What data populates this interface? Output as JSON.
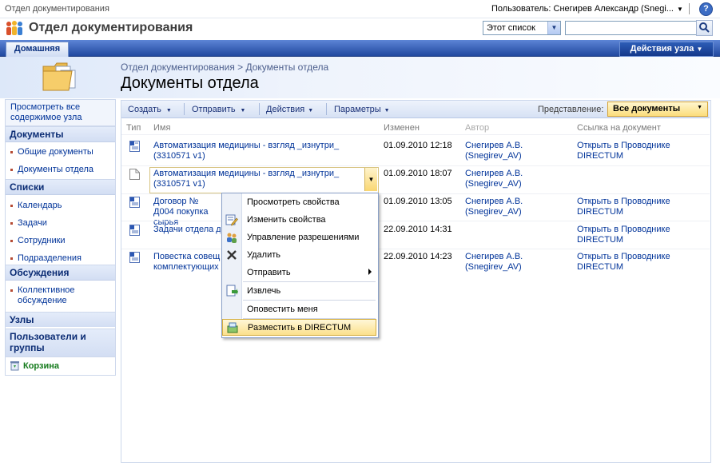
{
  "top": {
    "site_small": "Отдел документирования",
    "user": "Пользователь: Снегирев Александр (Snegi...",
    "help": "?"
  },
  "header": {
    "site_title": "Отдел документирования",
    "scope": "Этот список",
    "search_placeholder": ""
  },
  "tabs": {
    "home": "Домашняя",
    "site_actions": "Действия узла"
  },
  "title_area": {
    "breadcrumb": "Отдел документирования > Документы отдела",
    "page_title": "Документы отдела"
  },
  "nav": {
    "view_all": "Просмотреть все содержимое узла",
    "documents_head": "Документы",
    "documents": [
      "Общие документы",
      "Документы отдела"
    ],
    "lists_head": "Списки",
    "lists": [
      "Календарь",
      "Задачи",
      "Сотрудники",
      "Подразделения"
    ],
    "discussions_head": "Обсуждения",
    "discussions": [
      "Коллективное обсуждение"
    ],
    "sites_head": "Узлы",
    "people_head": "Пользователи и группы",
    "recycle": "Корзина"
  },
  "toolbar": {
    "create": "Создать",
    "send": "Отправить",
    "actions": "Действия",
    "settings": "Параметры",
    "view_label": "Представление:",
    "view_value": "Все документы"
  },
  "table": {
    "headers": [
      "Тип",
      "Имя",
      "Изменен",
      "Автор",
      "Ссылка на документ"
    ],
    "rows": [
      {
        "name": "Автоматизация медицины - взгляд _изнутри_ (3310571 v1)",
        "modified": "01.09.2010 12:18",
        "author": "Снегирев А.В. (Snegirev_AV)",
        "link": "Открыть в Проводнике DIRECTUM"
      },
      {
        "name": "Автоматизация медицины - взгляд _изнутри_ (3310571 v1)",
        "modified": "01.09.2010 18:07",
        "author": "Снегирев А.В. (Snegirev_AV)",
        "link": ""
      },
      {
        "name": "Договор № Д004 покупка сырья",
        "modified": "01.09.2010 13:05",
        "author": "Снегирев А.В. (Snegirev_AV)",
        "link": "Открыть в Проводнике DIRECTUM"
      },
      {
        "name": "Задачи отдела д",
        "modified": "22.09.2010 14:31",
        "author": "",
        "link": "Открыть в Проводнике DIRECTUM"
      },
      {
        "name": "Повестка совещ комплектующих",
        "modified": "22.09.2010 14:23",
        "author": "Снегирев А.В. (Snegirev_AV)",
        "link": "Открыть в Проводнике DIRECTUM"
      }
    ]
  },
  "context_menu": {
    "items": [
      "Просмотреть свойства",
      "Изменить свойства",
      "Управление разрешениями",
      "Удалить",
      "Отправить",
      "Извлечь",
      "Оповестить меня",
      "Разместить в DIRECTUM"
    ]
  },
  "colors": {
    "tab_bar": "#2b54ac",
    "highlight": "#fbe08c",
    "link": "#003399"
  }
}
